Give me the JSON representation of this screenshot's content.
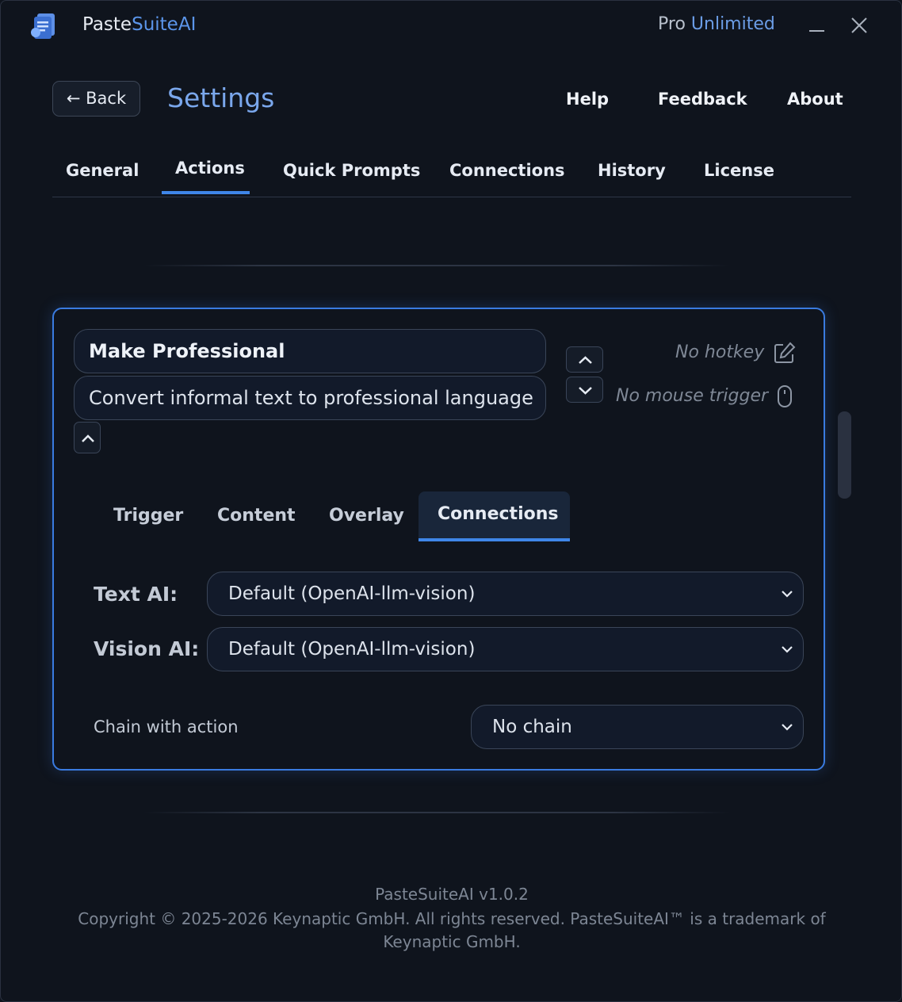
{
  "app": {
    "name_prefix": "Paste",
    "name_suffix": "SuiteAI",
    "plan_prefix": "Pro",
    "plan_suffix": "Unlimited"
  },
  "header": {
    "back_label": "← Back",
    "title": "Settings",
    "links": [
      "Help",
      "Feedback",
      "About"
    ]
  },
  "main_tabs": [
    "General",
    "Actions",
    "Quick Prompts",
    "Connections",
    "History",
    "License"
  ],
  "active_main_tab": "Actions",
  "action": {
    "name": "Make Professional",
    "description": "Convert informal text to professional language",
    "hotkey_text": "No hotkey",
    "mouse_trigger_text": "No mouse trigger"
  },
  "sub_tabs": [
    "Trigger",
    "Content",
    "Overlay",
    "Connections"
  ],
  "active_sub_tab": "Connections",
  "connections": {
    "text_ai_label": "Text AI:",
    "text_ai_value": "Default (OpenAI-llm-vision)",
    "vision_ai_label": "Vision AI:",
    "vision_ai_value": "Default (OpenAI-llm-vision)",
    "chain_label": "Chain with action",
    "chain_value": "No chain"
  },
  "footer": {
    "version": "PasteSuiteAI v1.0.2",
    "copyright": "Copyright © 2025-2026 Keynaptic GmbH. All rights reserved. PasteSuiteAI™ is a trademark of Keynaptic GmbH."
  },
  "colors": {
    "accent": "#3f86e8",
    "background": "#0f141d",
    "card_border": "#3a7be0"
  }
}
